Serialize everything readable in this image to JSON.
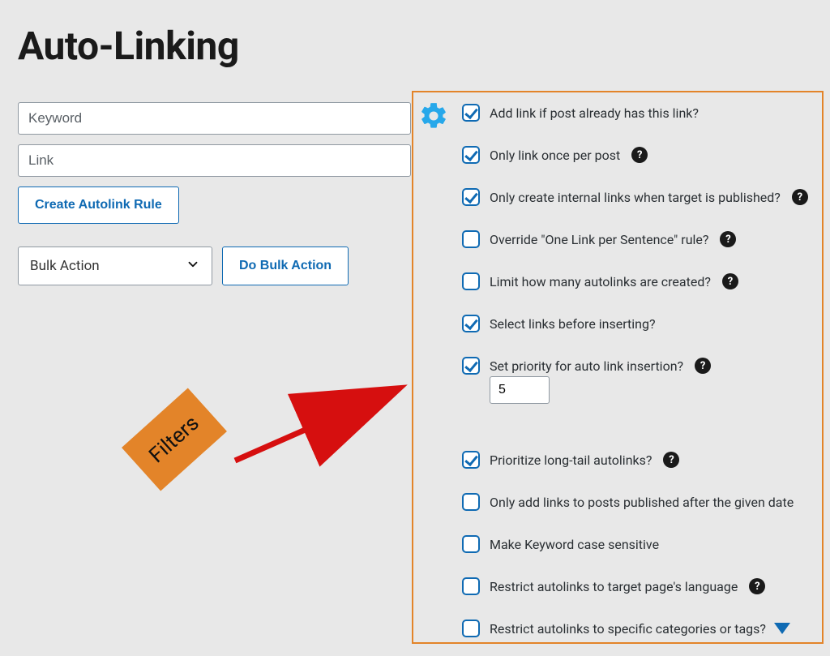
{
  "page": {
    "title": "Auto-Linking"
  },
  "inputs": {
    "keyword_placeholder": "Keyword",
    "link_placeholder": "Link"
  },
  "buttons": {
    "create_rule": "Create Autolink Rule",
    "do_bulk": "Do Bulk Action"
  },
  "bulk_select": {
    "value": "Bulk Action"
  },
  "annotation": {
    "filters": "Filters"
  },
  "settings": {
    "priority_value": "5",
    "opts": [
      {
        "key": "add_if_exists",
        "label": "Add link if post already has this link?",
        "checked": true,
        "help": false
      },
      {
        "key": "once_per_post",
        "label": "Only link once per post",
        "checked": true,
        "help": true
      },
      {
        "key": "internal_published",
        "label": "Only create internal links when target is published?",
        "checked": true,
        "help": true
      },
      {
        "key": "override_one",
        "label": "Override \"One Link per Sentence\" rule?",
        "checked": false,
        "help": true
      },
      {
        "key": "limit_count",
        "label": "Limit how many autolinks are created?",
        "checked": false,
        "help": true
      },
      {
        "key": "select_before",
        "label": "Select links before inserting?",
        "checked": true,
        "help": false
      },
      {
        "key": "set_priority",
        "label": "Set priority for auto link insertion?",
        "checked": true,
        "help": true
      },
      {
        "key": "prioritize_long",
        "label": "Prioritize long-tail autolinks?",
        "checked": true,
        "help": true
      },
      {
        "key": "after_date",
        "label": "Only add links to posts published after the given date",
        "checked": false,
        "help": false
      },
      {
        "key": "case_sensitive",
        "label": "Make Keyword case sensitive",
        "checked": false,
        "help": false
      },
      {
        "key": "restrict_lang",
        "label": "Restrict autolinks to target page's language",
        "checked": false,
        "help": true
      },
      {
        "key": "restrict_cats",
        "label": "Restrict autolinks to specific categories or tags?",
        "checked": false,
        "help": false
      }
    ]
  }
}
